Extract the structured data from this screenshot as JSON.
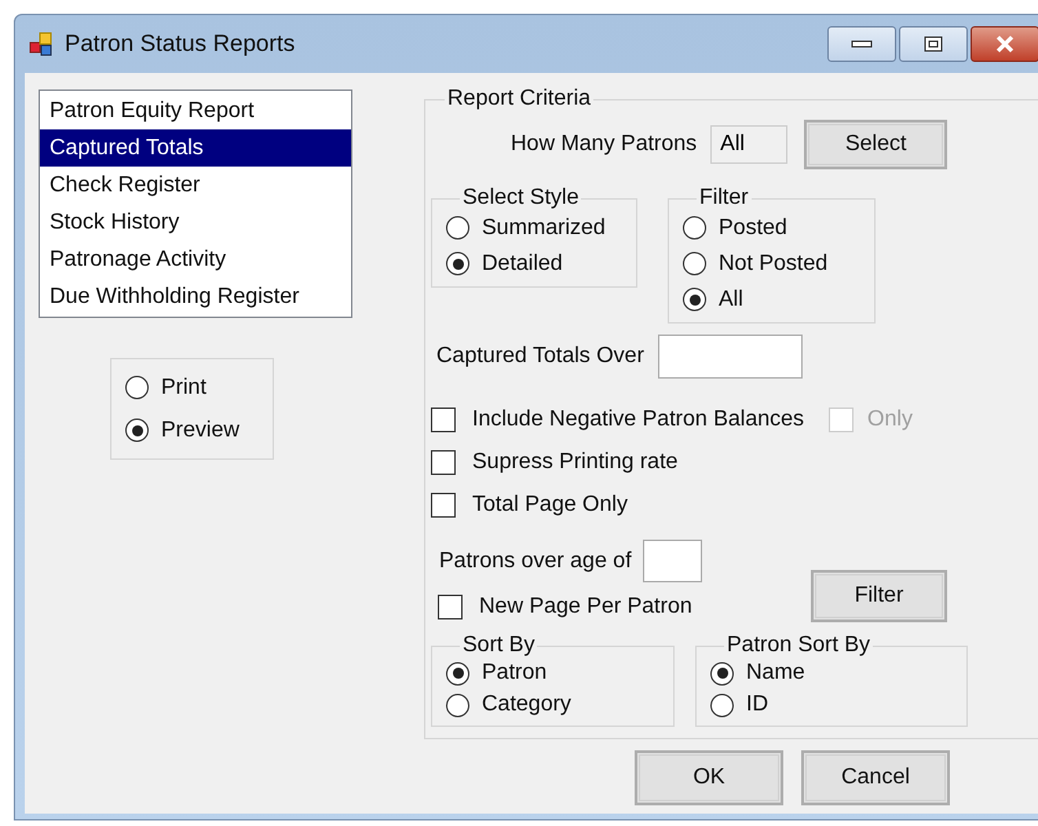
{
  "window": {
    "title": "Patron Status Reports"
  },
  "report_list": [
    {
      "label": "Patron Equity Report",
      "selected": false
    },
    {
      "label": "Captured Totals",
      "selected": true
    },
    {
      "label": "Check Register",
      "selected": false
    },
    {
      "label": "Stock History",
      "selected": false
    },
    {
      "label": "Patronage Activity",
      "selected": false
    },
    {
      "label": "Due Withholding Register",
      "selected": false
    }
  ],
  "output_options": [
    {
      "label": "Print",
      "selected": false
    },
    {
      "label": "Preview",
      "selected": true
    }
  ],
  "report_criteria": {
    "title": "Report Criteria",
    "how_many_patrons": {
      "label": "How Many Patrons",
      "value": "All"
    },
    "select_button": "Select",
    "select_style": {
      "title": "Select Style",
      "options": [
        {
          "label": "Summarized",
          "selected": false
        },
        {
          "label": "Detailed",
          "selected": true
        }
      ]
    },
    "filter": {
      "title": "Filter",
      "options": [
        {
          "label": "Posted",
          "selected": false
        },
        {
          "label": "Not Posted",
          "selected": false
        },
        {
          "label": "All",
          "selected": true
        }
      ]
    },
    "captured_totals_over": {
      "label": "Captured Totals Over"
    },
    "include_negative": {
      "label": "Include Negative Patron Balances",
      "checked": false
    },
    "only": {
      "label": "Only",
      "checked": false,
      "disabled": true
    },
    "supress_printing_rate": {
      "label": "Supress Printing rate",
      "checked": false
    },
    "total_page_only": {
      "label": "Total Page Only",
      "checked": false
    },
    "patrons_over_age": {
      "label": "Patrons over age of"
    },
    "new_page_per_patron": {
      "label": "New Page Per Patron",
      "checked": false
    },
    "filter_button": "Filter",
    "sort_by": {
      "title": "Sort By",
      "options": [
        {
          "label": "Patron",
          "selected": true
        },
        {
          "label": "Category",
          "selected": false
        }
      ]
    },
    "patron_sort_by": {
      "title": "Patron Sort By",
      "options": [
        {
          "label": "Name",
          "selected": true
        },
        {
          "label": "ID",
          "selected": false
        }
      ]
    }
  },
  "buttons": [
    "OK",
    "Cancel"
  ]
}
